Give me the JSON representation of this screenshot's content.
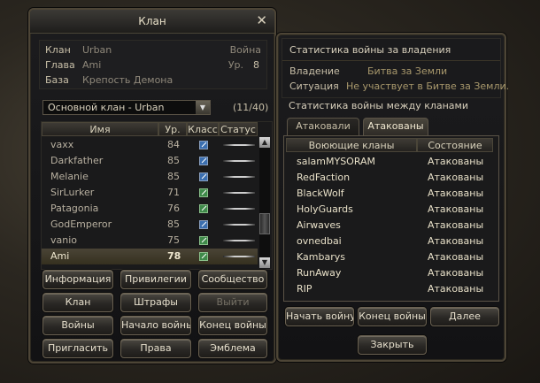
{
  "clan_window": {
    "title": "Клан",
    "info": {
      "clan_label": "Клан",
      "clan_value": "Urban",
      "war_label": "Война",
      "leader_label": "Глава",
      "leader_value": "Ami",
      "level_label": "Ур.",
      "level_value": "8",
      "base_label": "База",
      "base_value": "Крепость Демона"
    },
    "subclan_select": "Основной клан - Urban",
    "member_count": "(11/40)",
    "columns": {
      "name": "Имя",
      "level": "Ур.",
      "class": "Класс",
      "status": "Статус"
    },
    "members": [
      {
        "name": "vaxx",
        "level": "84",
        "class_icon": "class-icon-blue"
      },
      {
        "name": "Darkfather",
        "level": "85",
        "class_icon": "class-icon-blue"
      },
      {
        "name": "Melanie",
        "level": "85",
        "class_icon": "class-icon-blue"
      },
      {
        "name": "SirLurker",
        "level": "71",
        "class_icon": "class-icon-green"
      },
      {
        "name": "Patagonia",
        "level": "76",
        "class_icon": "class-icon-green"
      },
      {
        "name": "GodEmperor",
        "level": "85",
        "class_icon": "class-icon-blue"
      },
      {
        "name": "vanio",
        "level": "75",
        "class_icon": "class-icon-green"
      },
      {
        "name": "Ami",
        "level": "78",
        "class_icon": "class-icon-green",
        "selected": true
      }
    ],
    "buttons": {
      "info": "Информация",
      "privileges": "Привилегии",
      "community": "Сообщество",
      "clan": "Клан",
      "penalties": "Штрафы",
      "leave": "Выйти",
      "wars": "Войны",
      "war_start": "Начало войны",
      "war_end": "Конец войны",
      "invite": "Пригласить",
      "rights": "Права",
      "emblem": "Эмблема"
    }
  },
  "war_window": {
    "title": "Статистика войны за владения",
    "ownership_label": "Владение",
    "ownership_value": "Битва за Земли",
    "situation_label": "Ситуация",
    "situation_value": "Не участвует в Битве за Земли.",
    "clan_war_title": "Статистика войны между кланами",
    "tabs": {
      "attacked": "Атаковали",
      "attacking": "Атакованы"
    },
    "columns": {
      "clans": "Воюющие кланы",
      "state": "Состояние"
    },
    "wars": [
      {
        "clan": "salamMYSORAM",
        "state": "Атакованы"
      },
      {
        "clan": "RedFaction",
        "state": "Атакованы"
      },
      {
        "clan": "BlackWolf",
        "state": "Атакованы"
      },
      {
        "clan": "HolyGuards",
        "state": "Атакованы"
      },
      {
        "clan": "Airwaves",
        "state": "Атакованы"
      },
      {
        "clan": "ovnedbai",
        "state": "Атакованы"
      },
      {
        "clan": "Kambarys",
        "state": "Атакованы"
      },
      {
        "clan": "RunAway",
        "state": "Атакованы"
      },
      {
        "clan": "RIP",
        "state": "Атакованы"
      }
    ],
    "buttons": {
      "start_war": "Начать войну",
      "end_war": "Конец войны",
      "next": "Далее",
      "close": "Закрыть"
    }
  },
  "colors": {
    "accent_gold": "#c8b98a",
    "label_gray": "#8f887a",
    "value_gold": "#a8986c"
  }
}
